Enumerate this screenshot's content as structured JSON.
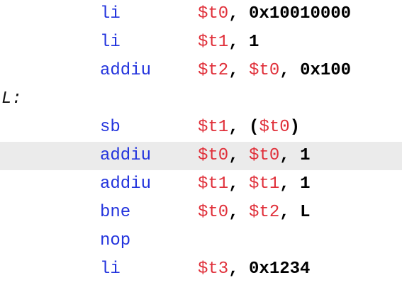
{
  "code": {
    "lines": [
      {
        "label": "",
        "mnemonic": "li",
        "highlighted": false,
        "operands": [
          {
            "t": "reg",
            "v": "$t0"
          },
          {
            "t": "punct",
            "v": ", "
          },
          {
            "t": "imm",
            "v": "0x10010000"
          }
        ]
      },
      {
        "label": "",
        "mnemonic": "li",
        "highlighted": false,
        "operands": [
          {
            "t": "reg",
            "v": "$t1"
          },
          {
            "t": "punct",
            "v": ", "
          },
          {
            "t": "imm",
            "v": "1"
          }
        ]
      },
      {
        "label": "",
        "mnemonic": "addiu",
        "highlighted": false,
        "operands": [
          {
            "t": "reg",
            "v": "$t2"
          },
          {
            "t": "punct",
            "v": ", "
          },
          {
            "t": "reg",
            "v": "$t0"
          },
          {
            "t": "punct",
            "v": ", "
          },
          {
            "t": "imm",
            "v": "0x100"
          }
        ]
      },
      {
        "label": "L:",
        "mnemonic": "",
        "highlighted": false,
        "operands": []
      },
      {
        "label": "",
        "mnemonic": "sb",
        "highlighted": false,
        "operands": [
          {
            "t": "reg",
            "v": "$t1"
          },
          {
            "t": "punct",
            "v": ", ("
          },
          {
            "t": "reg",
            "v": "$t0"
          },
          {
            "t": "punct",
            "v": ")"
          }
        ]
      },
      {
        "label": "",
        "mnemonic": "addiu",
        "highlighted": true,
        "operands": [
          {
            "t": "reg",
            "v": "$t0"
          },
          {
            "t": "punct",
            "v": ", "
          },
          {
            "t": "reg",
            "v": "$t0"
          },
          {
            "t": "punct",
            "v": ", "
          },
          {
            "t": "imm",
            "v": "1"
          }
        ]
      },
      {
        "label": "",
        "mnemonic": "addiu",
        "highlighted": false,
        "operands": [
          {
            "t": "reg",
            "v": "$t1"
          },
          {
            "t": "punct",
            "v": ", "
          },
          {
            "t": "reg",
            "v": "$t1"
          },
          {
            "t": "punct",
            "v": ", "
          },
          {
            "t": "imm",
            "v": "1"
          }
        ]
      },
      {
        "label": "",
        "mnemonic": "bne",
        "highlighted": false,
        "operands": [
          {
            "t": "reg",
            "v": "$t0"
          },
          {
            "t": "punct",
            "v": ", "
          },
          {
            "t": "reg",
            "v": "$t2"
          },
          {
            "t": "punct",
            "v": ", "
          },
          {
            "t": "imm",
            "v": "L"
          }
        ]
      },
      {
        "label": "",
        "mnemonic": "nop",
        "highlighted": false,
        "operands": []
      },
      {
        "label": "",
        "mnemonic": "li",
        "highlighted": false,
        "operands": [
          {
            "t": "reg",
            "v": "$t3"
          },
          {
            "t": "punct",
            "v": ", "
          },
          {
            "t": "imm",
            "v": "0x1234"
          }
        ]
      }
    ]
  },
  "colors": {
    "mnemonic": "#2233dd",
    "register": "#e0303a",
    "immediate": "#000000",
    "highlight_background": "#ebebeb",
    "background": "#ffffff"
  }
}
